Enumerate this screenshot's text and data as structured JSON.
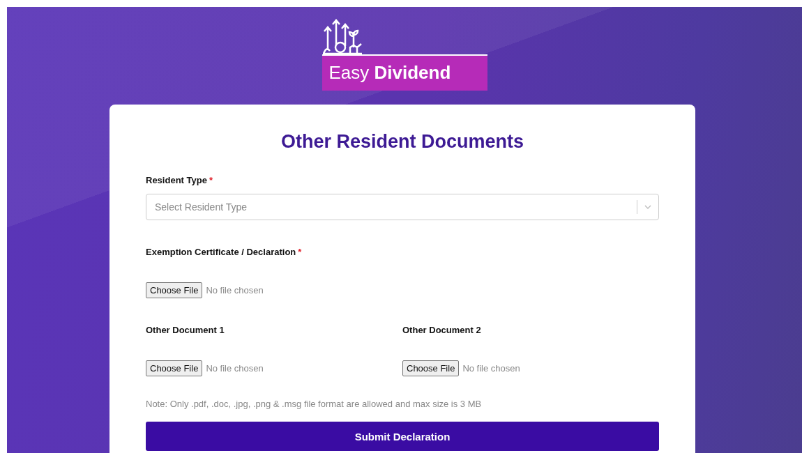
{
  "logo": {
    "text": "Easy **Dividend**"
  },
  "card": {
    "title": "Other Resident Documents",
    "rows": [
      {
        "fields": [
          {
            "kind": "select",
            "label": "Resident Type",
            "required_mark": "*",
            "placeholder": "Select Resident Type"
          }
        ]
      },
      {
        "fields": [
          {
            "kind": "file",
            "label": "Exemption Certificate / Declaration",
            "required_mark": "*",
            "button": "Choose File",
            "status": "No file chosen"
          }
        ]
      },
      {
        "fields": [
          {
            "kind": "file",
            "label": "Other Document 1",
            "button": "Choose File",
            "status": "No file chosen"
          },
          {
            "kind": "file",
            "label": "Other Document 2",
            "button": "Choose File",
            "status": "No file chosen"
          }
        ]
      }
    ],
    "note": "Note: Only .pdf, .doc, .jpg, .png & .msg file format are allowed and max size is 3 MB",
    "submit": "Submit Declaration"
  }
}
